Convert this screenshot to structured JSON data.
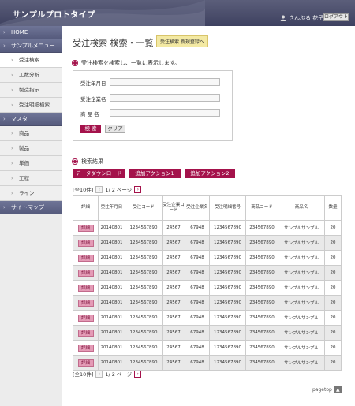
{
  "header": {
    "brand": "サンプルプロトタイプ",
    "user_name": "さんぷる 花子",
    "logout_label": "ログアウト"
  },
  "sidebar": {
    "items": [
      {
        "label": "HOME",
        "type": "main"
      },
      {
        "label": "サンプルメニュー",
        "type": "main"
      },
      {
        "label": "受注検索",
        "type": "sub",
        "active": true
      },
      {
        "label": "工数分析",
        "type": "sub"
      },
      {
        "label": "製造指示",
        "type": "sub"
      },
      {
        "label": "受注明細検索",
        "type": "sub"
      },
      {
        "label": "マスタ",
        "type": "main"
      },
      {
        "label": "商品",
        "type": "sub"
      },
      {
        "label": "製品",
        "type": "sub"
      },
      {
        "label": "単価",
        "type": "sub"
      },
      {
        "label": "工程",
        "type": "sub"
      },
      {
        "label": "ライン",
        "type": "sub"
      },
      {
        "label": "サイトマップ",
        "type": "main"
      }
    ]
  },
  "main": {
    "title": "受注検索 検索・一覧",
    "new_link": "受注検索 新規登録へ",
    "search_heading": "受注検索を検索し、一覧に表示します。",
    "fields": [
      {
        "label": "受注年月日",
        "value": ""
      },
      {
        "label": "受注企業名",
        "value": ""
      },
      {
        "label": "商 品 名",
        "value": ""
      }
    ],
    "search_button": "検 索",
    "clear_button": "クリア",
    "results_heading": "検索結果",
    "actions": [
      "データダウンロード",
      "追加アクション1",
      "追加アクション2"
    ],
    "pager": {
      "total": "[全10件]",
      "page": "1/ 2 ページ"
    },
    "table": {
      "headers": [
        "詳細",
        "受注年月日",
        "受注コード",
        "受注企業コード",
        "受注企業名",
        "受注明細番号",
        "商品コード",
        "商品名",
        "数量"
      ],
      "detail_label": "詳細",
      "rows": [
        [
          "20140801",
          "1234567890",
          "24567",
          "67948",
          "1234567890",
          "234567890",
          "サンプルサンプル",
          "20"
        ],
        [
          "20140801",
          "1234567890",
          "24567",
          "67948",
          "1234567890",
          "234567890",
          "サンプルサンプル",
          "20"
        ],
        [
          "20140801",
          "1234567890",
          "24567",
          "67948",
          "1234567890",
          "234567890",
          "サンプルサンプル",
          "20"
        ],
        [
          "20140801",
          "1234567890",
          "24567",
          "67948",
          "1234567890",
          "234567890",
          "サンプルサンプル",
          "20"
        ],
        [
          "20140801",
          "1234567890",
          "24567",
          "67948",
          "1234567890",
          "234567890",
          "サンプルサンプル",
          "20"
        ],
        [
          "20140801",
          "1234567890",
          "24567",
          "67948",
          "1234567890",
          "234567890",
          "サンプルサンプル",
          "20"
        ],
        [
          "20140801",
          "1234567890",
          "24567",
          "67948",
          "1234567890",
          "234567890",
          "サンプルサンプル",
          "20"
        ],
        [
          "20140801",
          "1234567890",
          "24567",
          "67948",
          "1234567890",
          "234567890",
          "サンプルサンプル",
          "20"
        ],
        [
          "20140801",
          "1234567890",
          "24567",
          "67948",
          "1234567890",
          "234567890",
          "サンプルサンプル",
          "20"
        ],
        [
          "20140801",
          "1234567890",
          "24567",
          "67948",
          "1234567890",
          "234567890",
          "サンプルサンプル",
          "20"
        ]
      ]
    },
    "pagetop_label": "pagetop"
  },
  "colors": {
    "accent": "#a4124b",
    "header": "#4a4d6b",
    "highlight": "#f3e9a3"
  }
}
